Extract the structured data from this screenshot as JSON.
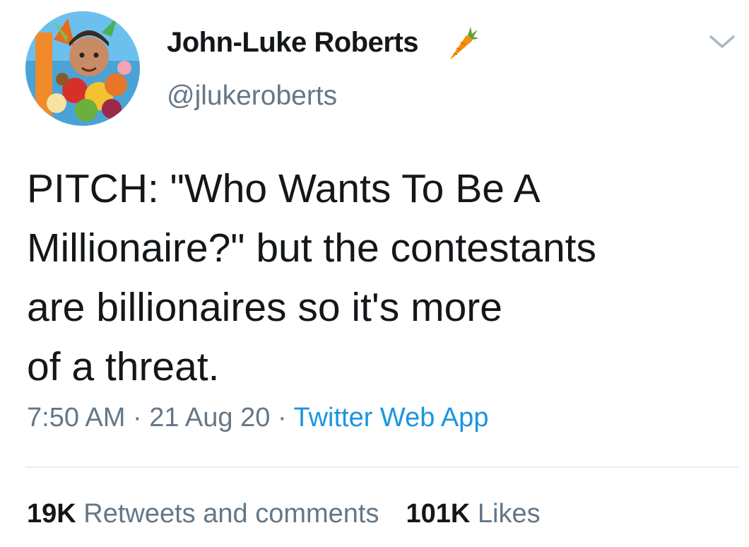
{
  "tweet": {
    "author": {
      "display_name": "John-Luke Roberts",
      "handle": "@jlukeroberts",
      "name_emoji_icon": "carrot-icon",
      "avatar_icon": "avatar-photo"
    },
    "menu_icon": "chevron-down-icon",
    "text_lines": [
      "PITCH: \"Who Wants To Be A",
      "Millionaire?\" but the contestants",
      "are billionaires so it's more",
      "of a threat."
    ],
    "time": "7:50 AM",
    "date": "21 Aug 20",
    "separator": "·",
    "source": "Twitter Web App",
    "stats": {
      "retweets_count": "19K",
      "retweets_label": "Retweets and comments",
      "likes_count": "101K",
      "likes_label": "Likes"
    },
    "colors": {
      "text": "#14171a",
      "secondary": "#657786",
      "link": "#1b95e0",
      "divider": "#e6ecf0"
    }
  }
}
